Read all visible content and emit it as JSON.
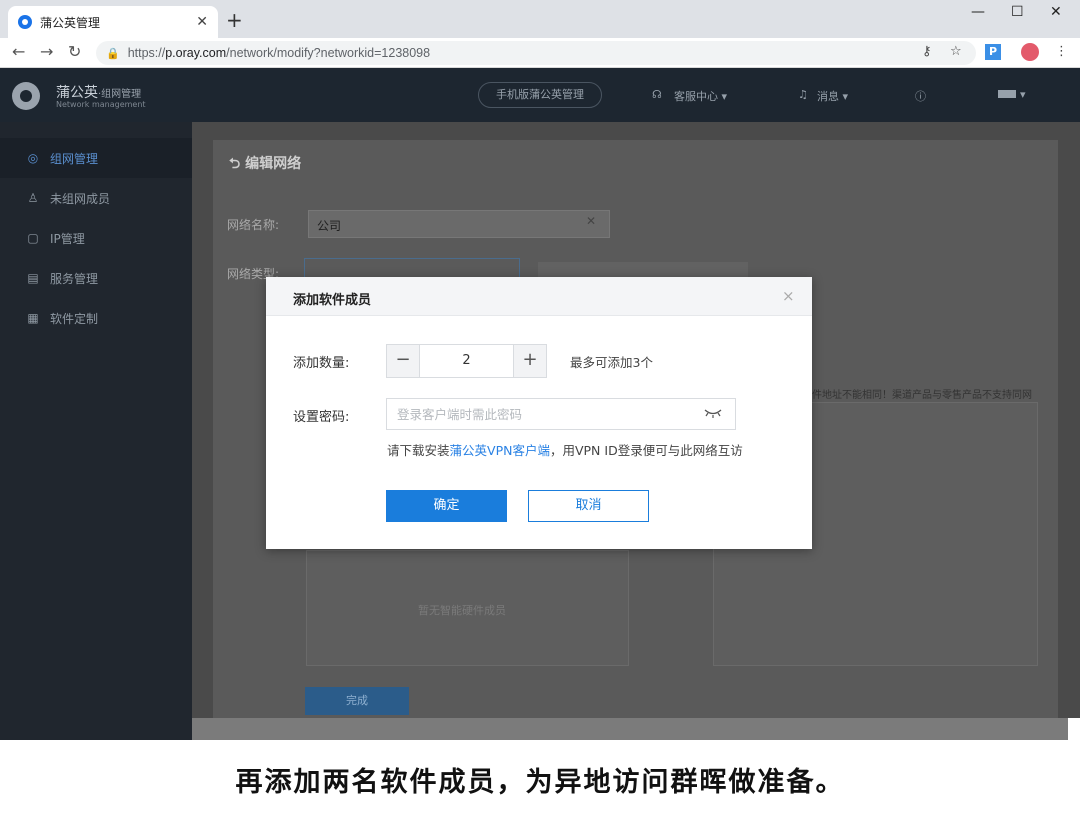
{
  "browser": {
    "tab_title": "蒲公英管理",
    "tab_close": "✕",
    "new_tab": "+",
    "window_controls": [
      "—",
      "☐",
      "✕"
    ],
    "nav": {
      "back": "←",
      "forward": "→",
      "reload": "↻"
    },
    "url_prefix": "https://",
    "url_host": "p.oray.com",
    "url_path": "/network/modify?networkid=1238098",
    "ext_label": "P"
  },
  "header": {
    "logo_name": "蒲公英",
    "logo_sub": "·组网管理",
    "logo_en": "Network management",
    "mobile_btn": "手机版蒲公英管理",
    "service": "客服中心 ▾",
    "messages": "消息 ▾",
    "user_menu": "▾"
  },
  "sidebar": {
    "items": [
      {
        "label": "组网管理",
        "icon": "network-icon"
      },
      {
        "label": "未组网成员",
        "icon": "user-icon"
      },
      {
        "label": "IP管理",
        "icon": "ip-icon"
      },
      {
        "label": "服务管理",
        "icon": "service-icon"
      },
      {
        "label": "软件定制",
        "icon": "grid-icon"
      }
    ]
  },
  "page": {
    "title": "编辑网络",
    "name_label": "网络名称:",
    "name_value": "公司",
    "type_label": "网络类型:",
    "empty_members": "暂无智能硬件成员",
    "right_note": "件地址不能相同！渠道产品与零售产品不支持同网",
    "done_btn": "完成"
  },
  "modal": {
    "title": "添加软件成员",
    "close": "×",
    "qty_label": "添加数量:",
    "qty_value": "2",
    "qty_minus": "−",
    "qty_plus": "+",
    "max_hint": "最多可添加3个",
    "pwd_label": "设置密码:",
    "pwd_placeholder": "登录客户端时需此密码",
    "help_prefix": "请下载安装",
    "help_link": "蒲公英VPN客户端",
    "help_suffix": "，用VPN ID登录便可与此网络互访",
    "ok": "确定",
    "cancel": "取消"
  },
  "caption": "再添加两名软件成员，为异地访问群晖做准备。"
}
